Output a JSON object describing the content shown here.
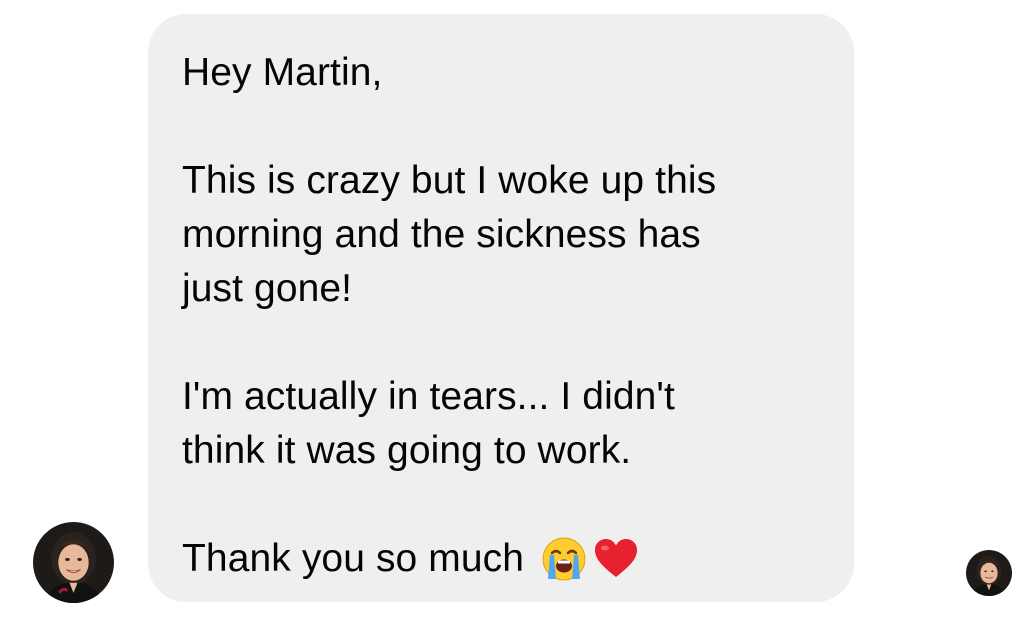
{
  "message": {
    "lines": [
      "Hey Martin,",
      "",
      "This is crazy but I woke up this",
      "morning and the sickness has",
      "just gone!",
      "",
      "I'm actually in tears... I didn't",
      "think it was going to work.",
      ""
    ],
    "final_text": "Thank you so much",
    "emojis": [
      "loudly-crying-face-icon",
      "red-heart-icon"
    ],
    "bubble_color": "#efefef",
    "text_color": "#050505"
  },
  "sender_avatar": {
    "icon": "sender-avatar"
  },
  "read_receipt": {
    "icon": "read-receipt-avatar"
  }
}
